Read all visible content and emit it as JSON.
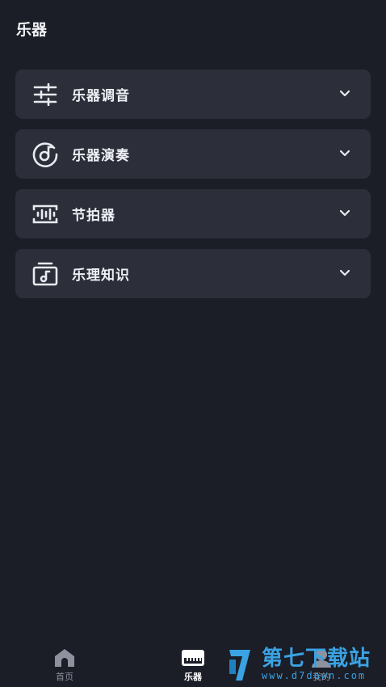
{
  "header": {
    "title": "乐器"
  },
  "menu": {
    "items": [
      {
        "label": "乐器调音",
        "icon": "sliders-icon"
      },
      {
        "label": "乐器演奏",
        "icon": "music-disc-icon"
      },
      {
        "label": "节拍器",
        "icon": "metronome-wave-icon"
      },
      {
        "label": "乐理知识",
        "icon": "music-book-icon"
      }
    ]
  },
  "tabbar": {
    "tabs": [
      {
        "label": "首页",
        "icon": "home-icon",
        "active": false
      },
      {
        "label": "乐器",
        "icon": "piano-keys-icon",
        "active": true
      },
      {
        "label": "我的",
        "icon": "profile-icon",
        "active": false
      }
    ]
  },
  "watermark": {
    "main": "第七下载站",
    "url": "www.d7down.com"
  },
  "colors": {
    "background": "#1b1d27",
    "card": "#2c2e39",
    "text": "#eef0f5",
    "inactive_tab": "#8e929e",
    "watermark": "#3aa3e3"
  }
}
